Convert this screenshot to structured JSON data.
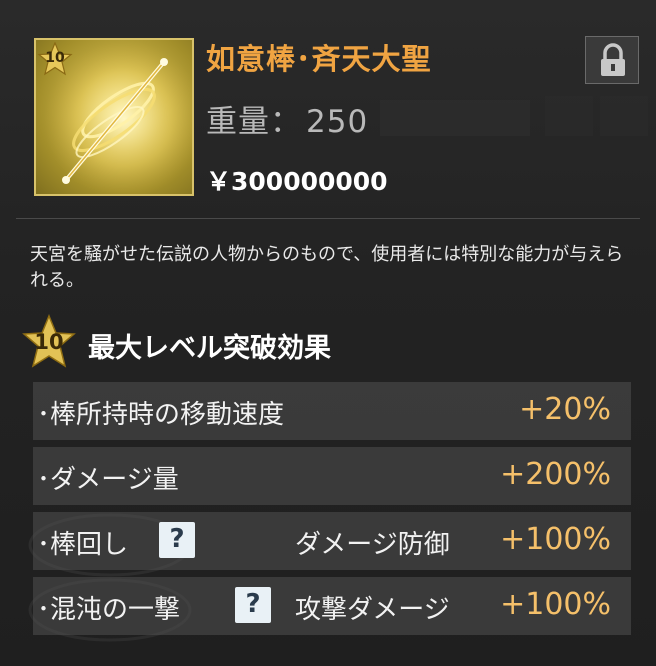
{
  "item": {
    "name": "如意棒･斉天大聖",
    "level_badge": "10",
    "weight_label": "重量：",
    "weight_value": "250",
    "price_symbol": "￥",
    "price_value": "300000000",
    "lock_icon": "lock-icon",
    "description": "天宮を騒がせた伝説の人物からのもので、使用者には特別な能力が与えられる。"
  },
  "breakthrough": {
    "level_badge": "10",
    "title": "最大レベル突破効果"
  },
  "effects": [
    {
      "label": "･棒所持時の移動速度",
      "help": false,
      "detail": "",
      "bonus": "+20%"
    },
    {
      "label": "･ダメージ量",
      "help": false,
      "detail": "",
      "bonus": "+200%"
    },
    {
      "label": "･棒回し",
      "help": true,
      "help_glyph": "?",
      "detail": "ダメージ防御",
      "bonus": "+100%"
    },
    {
      "label": "･混沌の一撃",
      "help": true,
      "help_glyph": "?",
      "detail": "攻撃ダメージ",
      "bonus": "+100%"
    }
  ],
  "colors": {
    "item_name": "#f0a442",
    "bonus": "#f5c06a",
    "frame": "#d8c26a"
  }
}
